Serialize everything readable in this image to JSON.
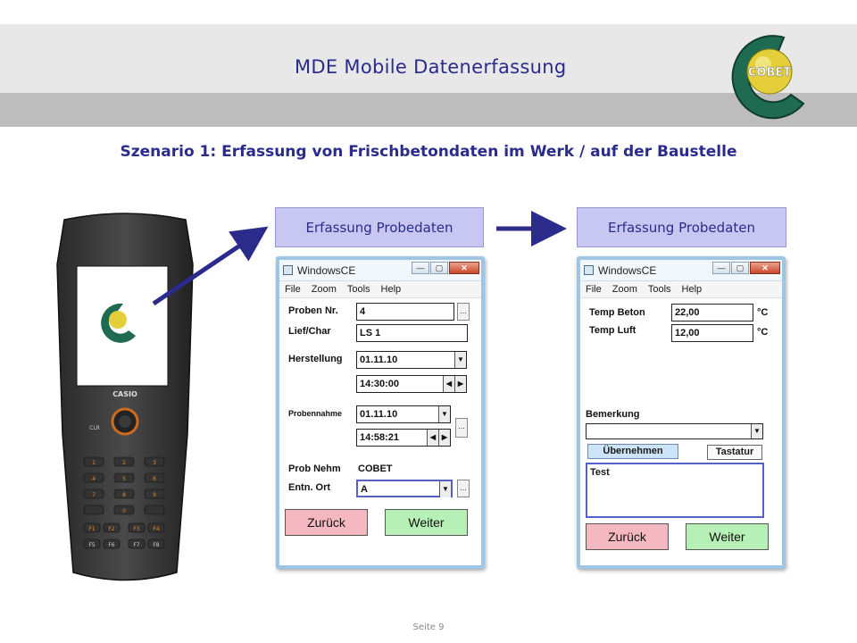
{
  "header": {
    "title": "MDE Mobile Datenerfassung",
    "logo_text": "COBET"
  },
  "subtitle": "Szenario 1: Erfassung von Frischbetondaten im Werk / auf der Baustelle",
  "device": {
    "brand": "CASIO",
    "keys": [
      "CLR",
      "1",
      "2",
      "3",
      "4",
      "5",
      "6",
      "7",
      "8",
      "9",
      "0",
      "F1",
      "F2",
      "F3",
      "F4",
      "F5",
      "F6",
      "F7",
      "F8"
    ]
  },
  "labels": {
    "left": "Erfassung Probedaten",
    "right": "Erfassung Probedaten"
  },
  "window1": {
    "title": "WindowsCE",
    "menu": [
      "File",
      "Zoom",
      "Tools",
      "Help"
    ],
    "probennr_label": "Proben Nr.",
    "probennr_value": "4",
    "liefchar_label": "Lief/Char",
    "liefchar_value": "LS 1",
    "herstellung_label": "Herstellung",
    "herstellung_date": "01.11.10",
    "herstellung_time": "14:30:00",
    "probennahme_label": "Probennahme",
    "probennahme_date": "01.11.10",
    "probennahme_time": "14:58:21",
    "probnehm_label": "Prob Nehm",
    "probnehm_value": "COBET",
    "entnort_label": "Entn. Ort",
    "entnort_value": "A",
    "back_label": "Zurück",
    "next_label": "Weiter",
    "dots": "..."
  },
  "window2": {
    "title": "WindowsCE",
    "menu": [
      "File",
      "Zoom",
      "Tools",
      "Help"
    ],
    "tempbeton_label": "Temp Beton",
    "tempbeton_value": "22,00",
    "templuft_label": "Temp Luft",
    "templuft_value": "12,00",
    "unit": "°C",
    "bemerkung_label": "Bemerkung",
    "bemerkung_value": "",
    "uebernehmen_label": "Übernehmen",
    "tastatur_label": "Tastatur",
    "memo_value": "Test",
    "back_label": "Zurück",
    "next_label": "Weiter"
  },
  "footer": "Seite 9",
  "colors": {
    "accent": "#2b2b8c",
    "label_bg": "#c7c7f2",
    "back_bg": "#f5b8c0",
    "next_bg": "#b6f0b6",
    "logo_green": "#1f6b52"
  }
}
